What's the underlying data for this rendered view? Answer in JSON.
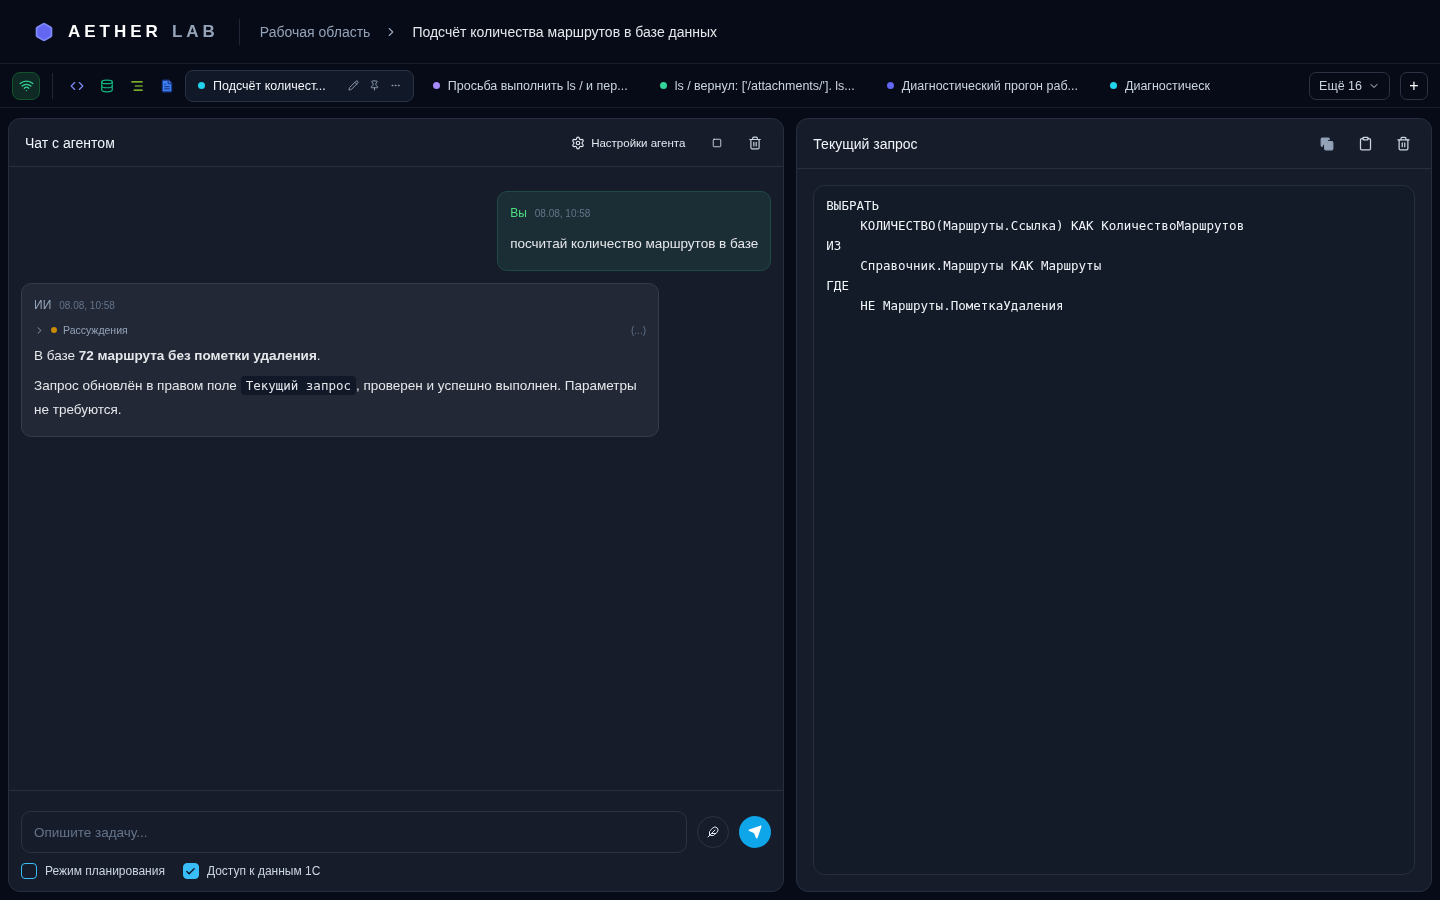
{
  "header": {
    "logo_primary": "AETHER",
    "logo_secondary": "LAB",
    "breadcrumbs": [
      "Рабочая область",
      "Подсчёт количества маршрутов в базе данных"
    ]
  },
  "tabs": [
    {
      "label": "Подсчёт количест...",
      "color": "#22d3ee",
      "selected": true
    },
    {
      "label": "Просьба выполнить ls / и пер...",
      "color": "#a78bfa",
      "selected": false
    },
    {
      "label": "ls / вернул: ['/attachments/']. ls...",
      "color": "#34d399",
      "selected": false
    },
    {
      "label": "Диагностический прогон раб...",
      "color": "#6366f1",
      "selected": false
    },
    {
      "label": "Диагностическ",
      "color": "#22d3ee",
      "selected": false
    }
  ],
  "more_tabs": "Ещё 16",
  "add_tab": "+",
  "chat": {
    "title": "Чат с агентом",
    "settings": "Настройки агента",
    "messages": [
      {
        "kind": "user",
        "author": "Вы",
        "time": "08.08, 10:58",
        "text": "посчитай количество маршрутов в базе"
      },
      {
        "kind": "ai",
        "author": "ИИ",
        "time": "08.08, 10:58",
        "reasoning": "Рассуждения",
        "reasoning_expanded": false,
        "reasoning_note": "(...)",
        "summary": "В базе **72 маршрута без пометки удаления**.",
        "text_before": "Запрос обновлён в правом поле",
        "code": "Текущий запрос",
        "text_after": ", проверен и успешно выполнен. Параметры не требуются."
      }
    ],
    "input": {
      "placeholder": "Опишите задачу..."
    },
    "options": [
      {
        "label": "Режим планирования",
        "checked": false
      },
      {
        "label": "Доступ к данным 1С",
        "checked": true
      }
    ]
  },
  "query": {
    "title": "Текущий запрос",
    "lines": [
      {
        "text": "ВЫБРАТЬ",
        "children": [
          {
            "text": "КОЛИЧЕСТВО(Маршруты.Ссылка) КАК КоличествоМаршрутов"
          }
        ]
      },
      {
        "text": "ИЗ",
        "children": [
          {
            "text": "Справочник.Маршруты КАК Маршруты"
          }
        ]
      },
      {
        "text": "ГДЕ",
        "children": [
          {
            "text": "НЕ Маршруты.ПометкаУдаления"
          }
        ]
      }
    ]
  }
}
